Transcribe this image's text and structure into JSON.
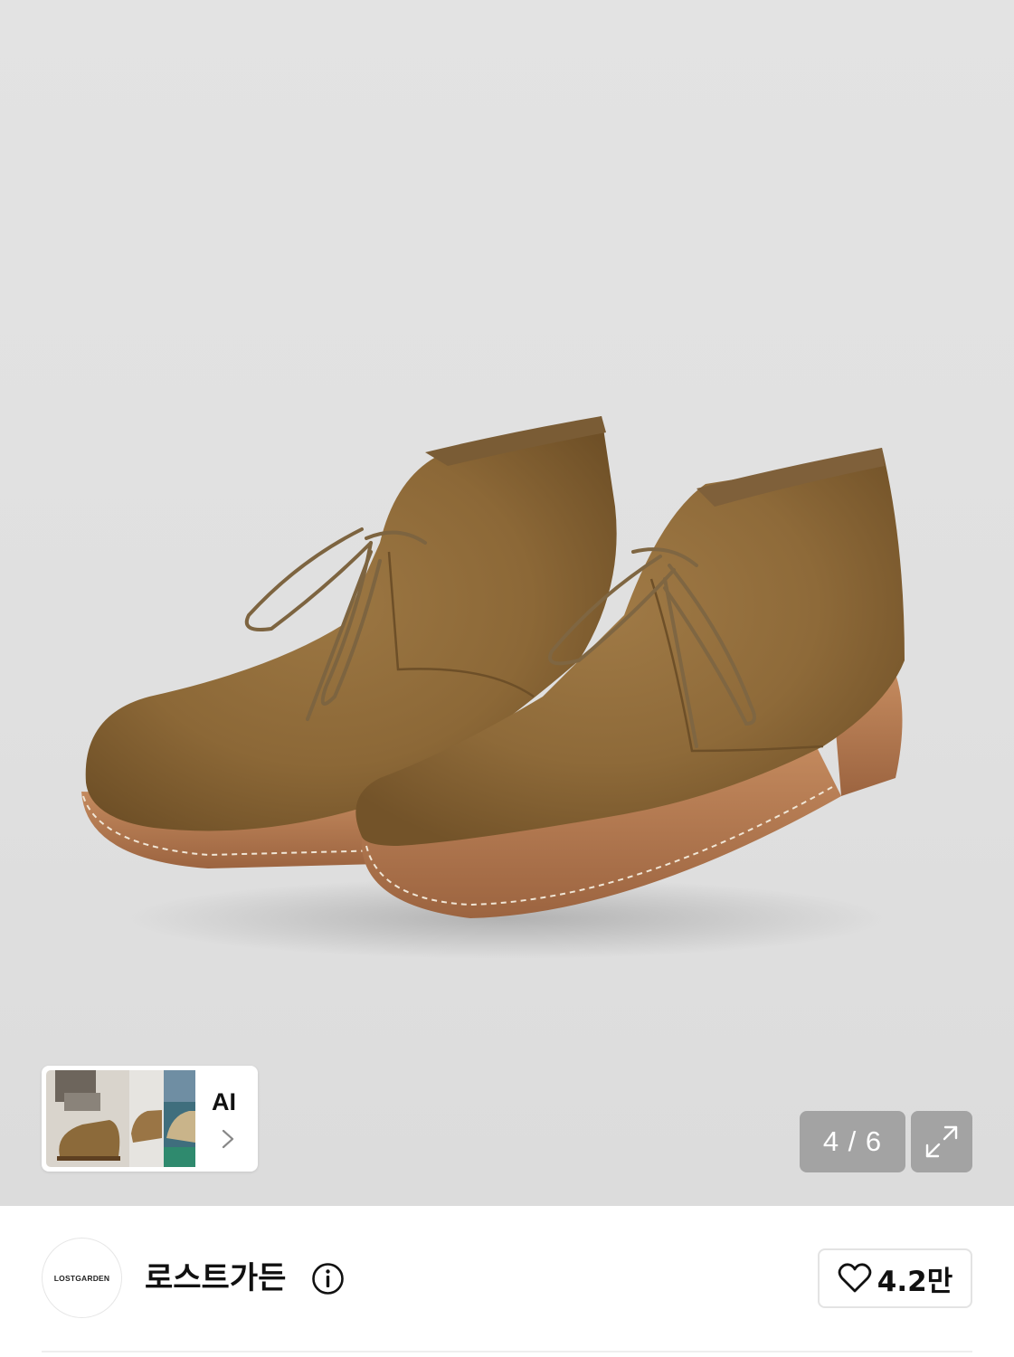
{
  "gallery": {
    "pager_current": "4",
    "pager_total": "6",
    "pager_separator": "/",
    "pager_text": "4 / 6",
    "ai_label": "AI",
    "expand_icon": "expand-arrows-icon"
  },
  "brand": {
    "name": "로스트가든",
    "logo_text": "LOSTGARDEN",
    "info_icon": "info-icon"
  },
  "like": {
    "count": "4.2만",
    "icon": "heart-outline-icon"
  },
  "colors": {
    "background": "#ffffff",
    "hero_background": "#e1e1e1",
    "suede": "#8f6a3a",
    "sole": "#b5774d",
    "pager_bg": "#969696"
  }
}
